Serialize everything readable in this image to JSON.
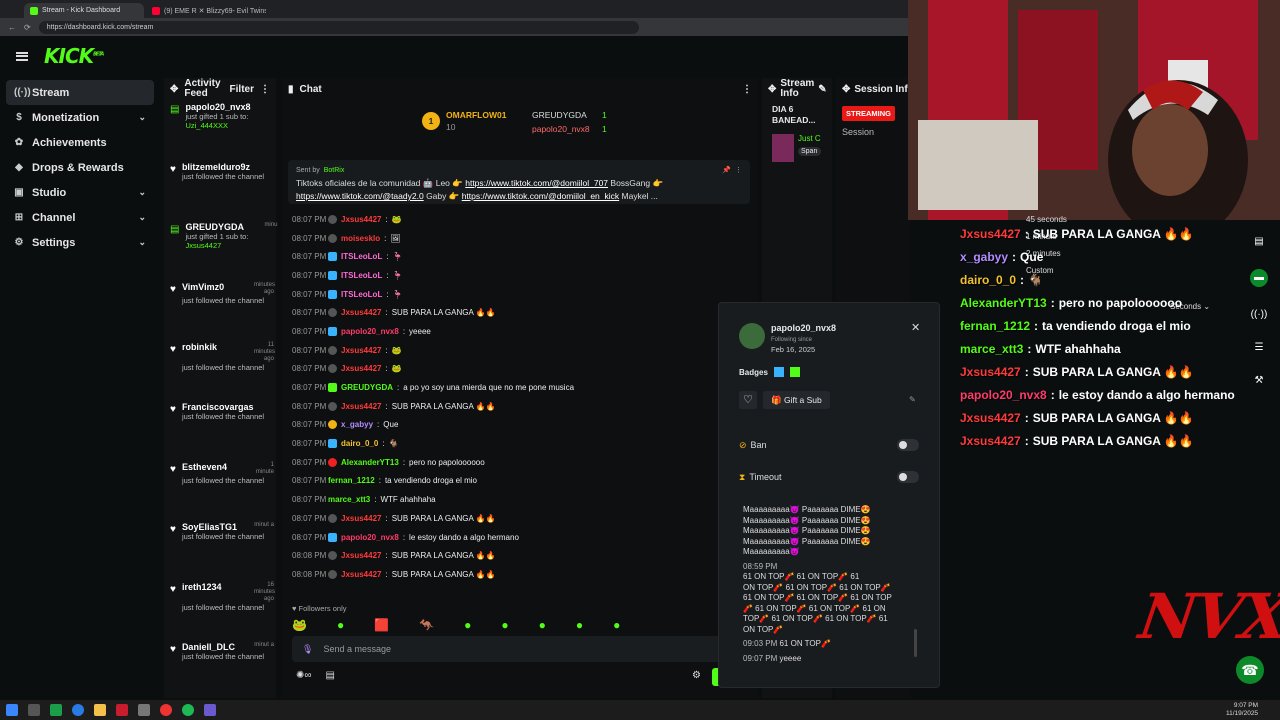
{
  "browser": {
    "tabs": [
      {
        "title": "Stream - Kick Dashboard",
        "color": "#53fc18"
      },
      {
        "title": "(9) EME R ✕ Blizzy69- Evil Twins M",
        "color": "#ff0033"
      }
    ],
    "url": "https://dashboard.kick.com/stream"
  },
  "brand": {
    "logo": "KICK",
    "tag": "BETA",
    "accent": "#53fc18"
  },
  "sidebar": {
    "items": [
      {
        "label": "Stream",
        "icon": "broadcast-icon",
        "glyph": "((·))"
      },
      {
        "label": "Monetization",
        "icon": "money-icon",
        "glyph": "$"
      },
      {
        "label": "Achievements",
        "icon": "trophy-icon",
        "glyph": "✿"
      },
      {
        "label": "Drops & Rewards",
        "icon": "gift-icon",
        "glyph": "◆"
      },
      {
        "label": "Studio",
        "icon": "studio-icon",
        "glyph": "▣"
      },
      {
        "label": "Channel",
        "icon": "channel-icon",
        "glyph": "⊞"
      },
      {
        "label": "Settings",
        "icon": "gear-icon",
        "glyph": "⚙"
      }
    ]
  },
  "feed": {
    "title": "Activity Feed",
    "filter": "Filter",
    "items": [
      {
        "name": "papolo20_nvx8",
        "when": "",
        "text": "just gifted 1 sub to:",
        "target": "Uzi_444XXX",
        "type": "gift"
      },
      {
        "name": "blitzemelduro9z",
        "when": "",
        "text": "just followed the channel",
        "target": "",
        "type": "follow"
      },
      {
        "name": "GREUDYGDA",
        "when": "minu",
        "text": "just gifted 1 sub to:",
        "target": "Jxsus4427",
        "type": "gift"
      },
      {
        "name": "VimVimz0",
        "when": "minutes ago",
        "text": "just followed the channel",
        "target": "",
        "type": "follow"
      },
      {
        "name": "robinkik",
        "when": "11 minutes ago",
        "text": "just followed the channel",
        "target": "",
        "type": "follow"
      },
      {
        "name": "Franciscovargas",
        "when": "",
        "text": "just followed the channel",
        "target": "",
        "type": "follow"
      },
      {
        "name": "Estheven4",
        "when": "1 minute",
        "text": "just followed the channel",
        "target": "",
        "type": "follow"
      },
      {
        "name": "SoyEliasTG1",
        "when": "minut a",
        "text": "just followed the channel",
        "target": "",
        "type": "follow"
      },
      {
        "name": "ireth1234",
        "when": "16 minutes ago",
        "text": "just followed the channel",
        "target": "",
        "type": "follow"
      },
      {
        "name": "Daniell_DLC",
        "when": "minut a",
        "text": "just followed the channel",
        "target": "",
        "type": "follow"
      }
    ]
  },
  "chat": {
    "title": "Chat",
    "top": [
      {
        "name": "OMARFLOW01",
        "count": "10"
      },
      {
        "name": "GREUDYGDA",
        "count": "1"
      },
      {
        "name": "papolo20_nvx8",
        "count": "1"
      }
    ],
    "pinned": {
      "sent_by_label": "Sent by",
      "sent_by": "BotRix",
      "line1_text": "Tiktoks oficiales de la comunidad 🤖 Leo 👉",
      "line1_link": "https://www.tiktok.com/@domiilol_707",
      "line1_after": "BossGang 👉",
      "line2_link1": "https://www.tiktok.com/@taady2.0",
      "line2_mid": "Gaby 👉",
      "line2_link2": "https://www.tiktok.com/@domiilol_en_kick",
      "line2_after": "Maykel ..."
    },
    "messages": [
      {
        "time": "08:07 PM",
        "badge": "grey",
        "user": "Jxsus4427",
        "color": "#ff3b3b",
        "text": "🐸"
      },
      {
        "time": "08:07 PM",
        "badge": "grey",
        "user": "moisesklo",
        "color": "#ff3b3b",
        "text": "🖼"
      },
      {
        "time": "08:07 PM",
        "badge": "blue",
        "user": "ITSLeoLoL",
        "color": "#ff6ad5",
        "text": "🦩"
      },
      {
        "time": "08:07 PM",
        "badge": "blue",
        "user": "ITSLeoLoL",
        "color": "#ff6ad5",
        "text": "🦩"
      },
      {
        "time": "08:07 PM",
        "badge": "blue",
        "user": "ITSLeoLoL",
        "color": "#ff6ad5",
        "text": "🦩"
      },
      {
        "time": "08:07 PM",
        "badge": "grey",
        "user": "Jxsus4427",
        "color": "#ff3b3b",
        "text": "SUB PARA LA GANGA 🔥🔥"
      },
      {
        "time": "08:07 PM",
        "badge": "blue",
        "user": "papolo20_nvx8",
        "color": "#ff3b6b",
        "text": "yeeee"
      },
      {
        "time": "08:07 PM",
        "badge": "grey",
        "user": "Jxsus4427",
        "color": "#ff3b3b",
        "text": "🐸"
      },
      {
        "time": "08:07 PM",
        "badge": "grey",
        "user": "Jxsus4427",
        "color": "#ff3b3b",
        "text": "🐸"
      },
      {
        "time": "08:07 PM",
        "badge": "green",
        "user": "GREUDYGDA",
        "color": "#53fc18",
        "text": "a po yo soy una mierda que no me pone musica"
      },
      {
        "time": "08:07 PM",
        "badge": "grey",
        "user": "Jxsus4427",
        "color": "#ff3b3b",
        "text": "SUB PARA LA GANGA 🔥🔥"
      },
      {
        "time": "08:07 PM",
        "badge": "gold",
        "user": "x_gabyy",
        "color": "#b38cff",
        "text": "Que"
      },
      {
        "time": "08:07 PM",
        "badge": "blue",
        "user": "dairo_0_0",
        "color": "#f1c232",
        "text": "🐐"
      },
      {
        "time": "08:07 PM",
        "badge": "red",
        "user": "AlexanderYT13",
        "color": "#53fc18",
        "text": "pero no papoloooooo"
      },
      {
        "time": "08:07 PM",
        "badge": "none",
        "user": "fernan_1212",
        "color": "#53fc18",
        "text": "ta vendiendo droga el mio"
      },
      {
        "time": "08:07 PM",
        "badge": "none",
        "user": "marce_xtt3",
        "color": "#53fc18",
        "text": "WTF ahahhaha"
      },
      {
        "time": "08:07 PM",
        "badge": "grey",
        "user": "Jxsus4427",
        "color": "#ff3b3b",
        "text": "SUB PARA LA GANGA 🔥🔥"
      },
      {
        "time": "08:07 PM",
        "badge": "blue",
        "user": "papolo20_nvx8",
        "color": "#ff3b6b",
        "text": "le estoy dando a algo hermano"
      },
      {
        "time": "08:08 PM",
        "badge": "grey",
        "user": "Jxsus4427",
        "color": "#ff3b3b",
        "text": "SUB PARA LA GANGA 🔥🔥"
      },
      {
        "time": "08:08 PM",
        "badge": "grey",
        "user": "Jxsus4427",
        "color": "#ff3b3b",
        "text": "SUB PARA LA GANGA 🔥🔥"
      }
    ],
    "mode": "Followers only",
    "placeholder": "Send a message"
  },
  "stream_info": {
    "title": "Stream Info",
    "stream_title": "DIA 6 BANEAD...",
    "category": "Just C",
    "tag": "Span"
  },
  "session": {
    "title": "Session Info",
    "status": "STREAMING",
    "label": "Session"
  },
  "user_card": {
    "username": "papolo20_nvx8",
    "following_label": "Following since",
    "following_date": "Feb 16, 2025",
    "badges_label": "Badges",
    "gift_label": "Gift a Sub",
    "ban_label": "Ban",
    "timeout_label": "Timeout",
    "history": [
      "Maaaaaaaaa😈 Paaaaaaa DIME😍",
      "Maaaaaaaaa😈 Paaaaaaa DIME😍",
      "Maaaaaaaaa😈 Paaaaaaa DIME😍",
      "Maaaaaaaaa😈 Paaaaaaa DIME😍",
      "Maaaaaaaaa😈"
    ],
    "msg2_time": "08:59 PM",
    "msg2_lines": [
      "61 ON TOP🧨 61 ON TOP🧨 61",
      "ON TOP🧨 61 ON TOP🧨 61 ON TOP🧨",
      "61 ON TOP🧨 61 ON TOP🧨 61 ON TOP",
      "🧨 61 ON TOP🧨 61 ON TOP🧨 61 ON",
      "TOP🧨 61 ON TOP🧨 61 ON TOP🧨 61",
      "ON TOP🧨"
    ],
    "msg3_time": "09:03 PM",
    "msg3_text": "61 ON TOP🧨",
    "msg4_time": "09:07 PM",
    "msg4_text": "yeeee"
  },
  "overlay_chat": {
    "timeout_options": [
      "45 seconds",
      "1 minute",
      "2 minutes",
      "Custom",
      "Seconds"
    ],
    "rows": [
      {
        "user": "Jxsus4427",
        "color": "#ff3b3b",
        "text": "SUB PARA LA GANGA 🔥🔥"
      },
      {
        "user": "x_gabyy",
        "color": "#b38cff",
        "text": "Que"
      },
      {
        "user": "dairo_0_0",
        "color": "#f1c232",
        "text": "🐐"
      },
      {
        "user": "AlexanderYT13",
        "color": "#53fc18",
        "text": "pero no papoloooooo"
      },
      {
        "user": "fernan_1212",
        "color": "#53fc18",
        "text": "ta vendiendo droga el mio"
      },
      {
        "user": "marce_xtt3",
        "color": "#53fc18",
        "text": "WTF ahahhaha"
      },
      {
        "user": "Jxsus4427",
        "color": "#ff3b3b",
        "text": "SUB PARA LA GANGA 🔥🔥"
      },
      {
        "user": "papolo20_nvx8",
        "color": "#ff3b6b",
        "text": "le estoy dando a algo hermano"
      },
      {
        "user": "Jxsus4427",
        "color": "#ff3b3b",
        "text": "SUB PARA LA GANGA 🔥🔥"
      },
      {
        "user": "Jxsus4427",
        "color": "#ff3b3b",
        "text": "SUB PARA LA GANGA 🔥🔥"
      }
    ]
  },
  "watermark": "NVX",
  "clock": {
    "time": "9:07 PM",
    "date": "11/19/2025"
  }
}
